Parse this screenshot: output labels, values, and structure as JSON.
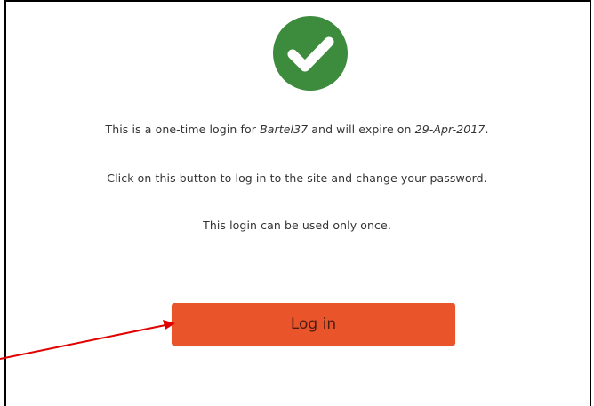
{
  "message": {
    "line1_prefix": "This is a one-time login for ",
    "line1_user": "Bartel37",
    "line1_mid": " and will expire on ",
    "line1_date": "29-Apr-2017",
    "line1_suffix": ".",
    "line2": "Click on this button to log in to the site and change your password.",
    "line3": "This login can be used only once."
  },
  "button": {
    "login_label": "Log in"
  },
  "icons": {
    "success": "check-circle-icon"
  },
  "colors": {
    "success_green": "#3d8b3d",
    "button_orange": "#e9542b",
    "annotation_arrow": "#e00000"
  }
}
